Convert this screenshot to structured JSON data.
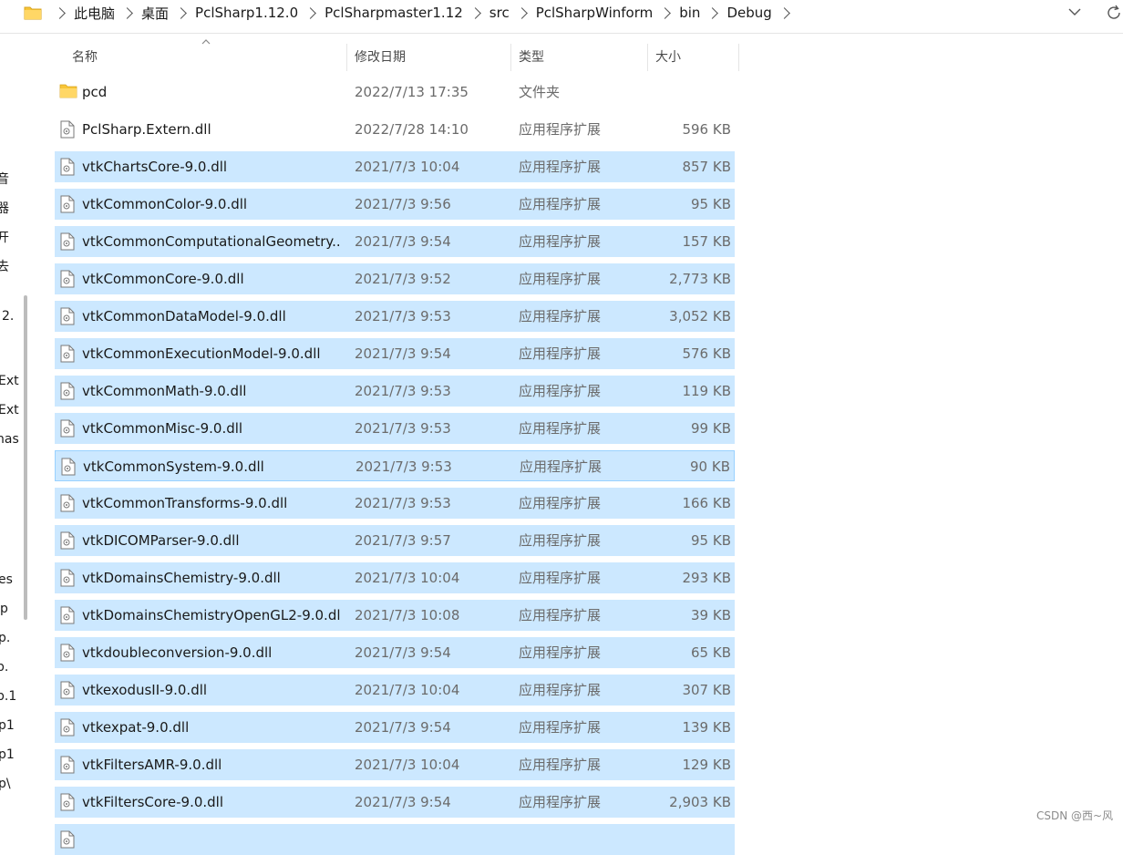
{
  "breadcrumb": [
    "此电脑",
    "桌面",
    "PclSharp1.12.0",
    "PclSharpmaster1.12",
    "src",
    "PclSharpWinform",
    "bin",
    "Debug"
  ],
  "columns": {
    "name": "名称",
    "date": "修改日期",
    "type": "类型",
    "size": "大小"
  },
  "nav_fragments": [
    "音",
    "器",
    "开",
    "去",
    "2.",
    "Ext",
    "Ext",
    "nas",
    "es",
    "p",
    "p.",
    "p.",
    "p.1",
    "p1",
    "p1",
    "p\\"
  ],
  "files": [
    {
      "icon": "folder-icon",
      "name": "pcd",
      "date": "2022/7/13 17:35",
      "type": "文件夹",
      "size": "",
      "selected": false
    },
    {
      "icon": "dll-file-icon",
      "name": "PclSharp.Extern.dll",
      "date": "2022/7/28 14:10",
      "type": "应用程序扩展",
      "size": "596 KB",
      "selected": false
    },
    {
      "icon": "dll-file-icon",
      "name": "vtkChartsCore-9.0.dll",
      "date": "2021/7/3 10:04",
      "type": "应用程序扩展",
      "size": "857 KB",
      "selected": true
    },
    {
      "icon": "dll-file-icon",
      "name": "vtkCommonColor-9.0.dll",
      "date": "2021/7/3 9:56",
      "type": "应用程序扩展",
      "size": "95 KB",
      "selected": true
    },
    {
      "icon": "dll-file-icon",
      "name": "vtkCommonComputationalGeometry...",
      "date": "2021/7/3 9:54",
      "type": "应用程序扩展",
      "size": "157 KB",
      "selected": true
    },
    {
      "icon": "dll-file-icon",
      "name": "vtkCommonCore-9.0.dll",
      "date": "2021/7/3 9:52",
      "type": "应用程序扩展",
      "size": "2,773 KB",
      "selected": true
    },
    {
      "icon": "dll-file-icon",
      "name": "vtkCommonDataModel-9.0.dll",
      "date": "2021/7/3 9:53",
      "type": "应用程序扩展",
      "size": "3,052 KB",
      "selected": true
    },
    {
      "icon": "dll-file-icon",
      "name": "vtkCommonExecutionModel-9.0.dll",
      "date": "2021/7/3 9:54",
      "type": "应用程序扩展",
      "size": "576 KB",
      "selected": true
    },
    {
      "icon": "dll-file-icon",
      "name": "vtkCommonMath-9.0.dll",
      "date": "2021/7/3 9:53",
      "type": "应用程序扩展",
      "size": "119 KB",
      "selected": true
    },
    {
      "icon": "dll-file-icon",
      "name": "vtkCommonMisc-9.0.dll",
      "date": "2021/7/3 9:53",
      "type": "应用程序扩展",
      "size": "99 KB",
      "selected": true
    },
    {
      "icon": "dll-file-icon",
      "name": "vtkCommonSystem-9.0.dll",
      "date": "2021/7/3 9:53",
      "type": "应用程序扩展",
      "size": "90 KB",
      "selected": true,
      "focused": true
    },
    {
      "icon": "dll-file-icon",
      "name": "vtkCommonTransforms-9.0.dll",
      "date": "2021/7/3 9:53",
      "type": "应用程序扩展",
      "size": "166 KB",
      "selected": true
    },
    {
      "icon": "dll-file-icon",
      "name": "vtkDICOMParser-9.0.dll",
      "date": "2021/7/3 9:57",
      "type": "应用程序扩展",
      "size": "95 KB",
      "selected": true
    },
    {
      "icon": "dll-file-icon",
      "name": "vtkDomainsChemistry-9.0.dll",
      "date": "2021/7/3 10:04",
      "type": "应用程序扩展",
      "size": "293 KB",
      "selected": true
    },
    {
      "icon": "dll-file-icon",
      "name": "vtkDomainsChemistryOpenGL2-9.0.dll",
      "date": "2021/7/3 10:08",
      "type": "应用程序扩展",
      "size": "39 KB",
      "selected": true
    },
    {
      "icon": "dll-file-icon",
      "name": "vtkdoubleconversion-9.0.dll",
      "date": "2021/7/3 9:54",
      "type": "应用程序扩展",
      "size": "65 KB",
      "selected": true
    },
    {
      "icon": "dll-file-icon",
      "name": "vtkexodusII-9.0.dll",
      "date": "2021/7/3 10:04",
      "type": "应用程序扩展",
      "size": "307 KB",
      "selected": true
    },
    {
      "icon": "dll-file-icon",
      "name": "vtkexpat-9.0.dll",
      "date": "2021/7/3 9:54",
      "type": "应用程序扩展",
      "size": "139 KB",
      "selected": true
    },
    {
      "icon": "dll-file-icon",
      "name": "vtkFiltersAMR-9.0.dll",
      "date": "2021/7/3 10:04",
      "type": "应用程序扩展",
      "size": "129 KB",
      "selected": true
    },
    {
      "icon": "dll-file-icon",
      "name": "vtkFiltersCore-9.0.dll",
      "date": "2021/7/3 9:54",
      "type": "应用程序扩展",
      "size": "2,903 KB",
      "selected": true
    },
    {
      "icon": "dll-file-icon",
      "name": "",
      "date": "",
      "type": "",
      "size": "",
      "selected": true
    }
  ],
  "watermark": "CSDN @西~风",
  "colors": {
    "selection": "#cce8ff",
    "selection_border": "#99d1ff",
    "folder": "#f8c537"
  }
}
